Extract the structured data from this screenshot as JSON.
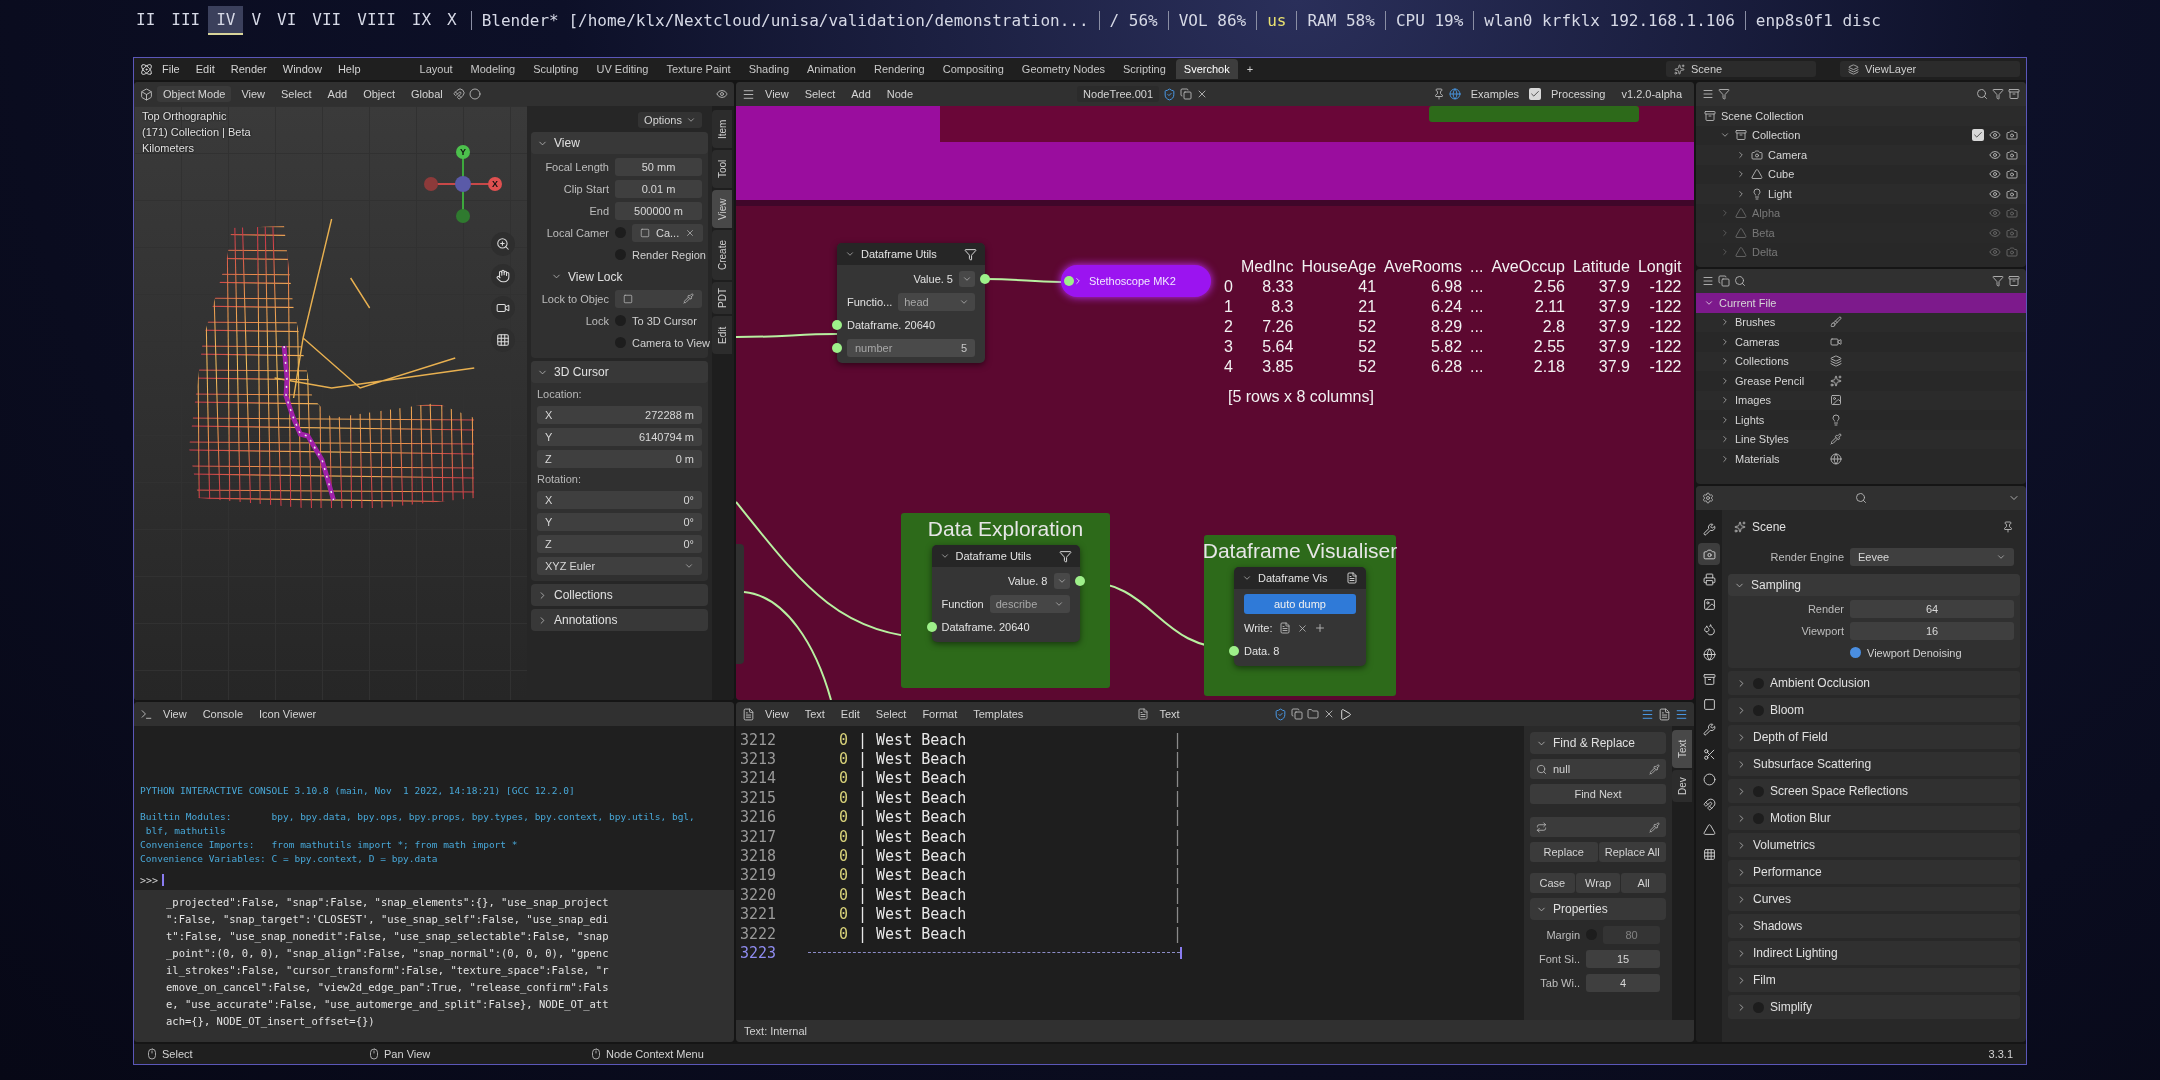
{
  "desktop_bar": {
    "workspaces": [
      {
        "label": "II",
        "selected": false
      },
      {
        "label": "III",
        "selected": false
      },
      {
        "label": "IV",
        "selected": true
      },
      {
        "label": "V",
        "selected": false
      },
      {
        "label": "VI",
        "selected": false
      },
      {
        "label": "VII",
        "selected": false
      },
      {
        "label": "VIII",
        "selected": false
      },
      {
        "label": "IX",
        "selected": false
      },
      {
        "label": "X",
        "selected": false
      }
    ],
    "title": "Blender* [/home/klx/Nextcloud/unisa/validation/demonstration...",
    "stats": [
      "/ 56%",
      "VOL 86%",
      "us",
      "RAM 58%",
      "CPU 19%",
      "wlan0 krfklx 192.168.1.106",
      "enp8s0f1 disc"
    ]
  },
  "topbar": {
    "menus": [
      "File",
      "Edit",
      "Render",
      "Window",
      "Help"
    ],
    "workspace_tabs": [
      {
        "label": "Layout",
        "selected": false
      },
      {
        "label": "Modeling",
        "selected": false
      },
      {
        "label": "Sculpting",
        "selected": false
      },
      {
        "label": "UV Editing",
        "selected": false
      },
      {
        "label": "Texture Paint",
        "selected": false
      },
      {
        "label": "Shading",
        "selected": false
      },
      {
        "label": "Animation",
        "selected": false
      },
      {
        "label": "Rendering",
        "selected": false
      },
      {
        "label": "Compositing",
        "selected": false
      },
      {
        "label": "Geometry Nodes",
        "selected": false
      },
      {
        "label": "Scripting",
        "selected": false
      },
      {
        "label": "Sverchok",
        "selected": true
      }
    ],
    "add_tab": "+",
    "scene": "Scene",
    "view_layer": "ViewLayer"
  },
  "viewport": {
    "mode": "Object Mode",
    "menus": [
      "View",
      "Select",
      "Add",
      "Object"
    ],
    "orientation": "Global",
    "options": "Options",
    "overlay": [
      "Top Orthographic",
      "(171) Collection | Beta",
      "Kilometers"
    ],
    "gizmo": {
      "y": "Y",
      "x": "X"
    },
    "sidebar_tabs": [
      {
        "label": "Item",
        "selected": false
      },
      {
        "label": "Tool",
        "selected": false
      },
      {
        "label": "View",
        "selected": true
      },
      {
        "label": "Create",
        "selected": false
      },
      {
        "label": "PDT",
        "selected": false
      },
      {
        "label": "Edit",
        "selected": false
      }
    ],
    "view_panel": {
      "title": "View",
      "rows": [
        {
          "kind": "field",
          "label": "Focal Length",
          "value": "50 mm"
        },
        {
          "kind": "field",
          "label": "Clip Start",
          "value": "0.01 m"
        },
        {
          "kind": "field",
          "label": "End",
          "value": "500000 m"
        },
        {
          "kind": "camera",
          "label": "Local Camer",
          "checked": false,
          "value": "Ca..."
        },
        {
          "kind": "check",
          "label": "Render Region",
          "checked": false
        },
        {
          "kind": "subhead",
          "label": "View Lock"
        },
        {
          "kind": "picker",
          "label": "Lock to Objec"
        },
        {
          "kind": "check",
          "prefix": "Lock",
          "label": "To 3D Cursor",
          "checked": false
        },
        {
          "kind": "check",
          "label": "Camera to View",
          "checked": false
        }
      ]
    },
    "cursor_panel": {
      "title": "3D Cursor",
      "rows": [
        {
          "kind": "caption",
          "label": "Location:"
        },
        {
          "kind": "vector",
          "label": "X",
          "value": "272288 m"
        },
        {
          "kind": "vector",
          "label": "Y",
          "value": "6140794 m"
        },
        {
          "kind": "vector",
          "label": "Z",
          "value": "0 m"
        },
        {
          "kind": "caption",
          "label": "Rotation:"
        },
        {
          "kind": "vector",
          "label": "X",
          "value": "0°"
        },
        {
          "kind": "vector",
          "label": "Y",
          "value": "0°"
        },
        {
          "kind": "vector",
          "label": "Z",
          "value": "0°"
        },
        {
          "kind": "select",
          "value": "XYZ Euler"
        }
      ]
    },
    "collapsed_panels": [
      "Collections",
      "Annotations"
    ]
  },
  "console": {
    "menus": [
      "View",
      "Console",
      "Icon Viewer"
    ],
    "banner": [
      "PYTHON INTERACTIVE CONSOLE 3.10.8 (main, Nov  1 2022, 14:18:21) [GCC 12.2.0]",
      "Builtin Modules:       bpy, bpy.data, bpy.ops, bpy.props, bpy.types, bpy.context, bpy.utils, bgl,",
      " blf, mathutils",
      "Convenience Imports:   from mathutils import *; from math import *",
      "Convenience Variables: C = bpy.context, D = bpy.data"
    ],
    "prompt": ">>>",
    "report": [
      "_projected\":False, \"snap\":False, \"snap_elements\":{}, \"use_snap_project",
      "\":False, \"snap_target\":'CLOSEST', \"use_snap_self\":False, \"use_snap_edi",
      "t\":False, \"use_snap_nonedit\":False, \"use_snap_selectable\":False, \"snap",
      "_point\":(0, 0, 0), \"snap_align\":False, \"snap_normal\":(0, 0, 0), \"gpenc",
      "il_strokes\":False, \"cursor_transform\":False, \"texture_space\":False, \"r",
      "emove_on_cancel\":False, \"view2d_edge_pan\":True, \"release_confirm\":Fals",
      "e, \"use_accurate\":False, \"use_automerge_and_split\":False}, NODE_OT_att",
      "ach={}, NODE_OT_insert_offset={})"
    ]
  },
  "node_editor": {
    "menus": [
      "View",
      "Select",
      "Add",
      "Node"
    ],
    "tree": "NodeTree.001",
    "examples": "Examples",
    "processing": {
      "label": "Processing",
      "checked": true
    },
    "version": "v1.2.0-alpha",
    "utils_node": {
      "title": "Dataframe Utils",
      "value": "Value. 5",
      "function_label": "Functio...",
      "function": "head",
      "input": "Dataframe. 20640",
      "number_label": "number",
      "number": "5"
    },
    "stethoscope": {
      "title": "Stethoscope MK2",
      "columns": [
        "",
        "MedInc",
        "HouseAge",
        "AveRooms",
        "...",
        "AveOccup",
        "Latitude",
        "Longit"
      ],
      "rows": [
        [
          "0",
          "8.33",
          "41",
          "6.98",
          "...",
          "2.56",
          "37.9",
          "-122"
        ],
        [
          "1",
          "8.3",
          "21",
          "6.24",
          "...",
          "2.11",
          "37.9",
          "-122"
        ],
        [
          "2",
          "7.26",
          "52",
          "8.29",
          "...",
          "2.8",
          "37.9",
          "-122"
        ],
        [
          "3",
          "5.64",
          "52",
          "5.82",
          "...",
          "2.55",
          "37.9",
          "-122"
        ],
        [
          "4",
          "3.85",
          "52",
          "6.28",
          "...",
          "2.18",
          "37.9",
          "-122"
        ]
      ],
      "summary": "[5 rows x 8 columns]"
    },
    "exploration_frame": {
      "title": "Data Exploration",
      "node": {
        "title": "Dataframe Utils",
        "value": "Value. 8",
        "function_label": "Function",
        "function": "describe",
        "input": "Dataframe. 20640"
      }
    },
    "visualiser_frame": {
      "title": "Dataframe Visualiser",
      "node": {
        "title": "Dataframe Vis",
        "button": {
          "label": "auto dump",
          "on": true
        },
        "write_label": "Write:",
        "input": "Data. 8"
      }
    }
  },
  "text_editor": {
    "menus": [
      "View",
      "Text",
      "Edit",
      "Select",
      "Format",
      "Templates"
    ],
    "text": "Text",
    "lines": [
      {
        "number": "3212",
        "count": "0",
        "text": "| West Beach",
        "end": "|",
        "current": false
      },
      {
        "number": "3213",
        "count": "0",
        "text": "| West Beach",
        "end": "|",
        "current": false
      },
      {
        "number": "3214",
        "count": "0",
        "text": "| West Beach",
        "end": "|",
        "current": false
      },
      {
        "number": "3215",
        "count": "0",
        "text": "| West Beach",
        "end": "|",
        "current": false
      },
      {
        "number": "3216",
        "count": "0",
        "text": "| West Beach",
        "end": "|",
        "current": false
      },
      {
        "number": "3217",
        "count": "0",
        "text": "| West Beach",
        "end": "|",
        "current": false
      },
      {
        "number": "3218",
        "count": "0",
        "text": "| West Beach",
        "end": "|",
        "current": false
      },
      {
        "number": "3219",
        "count": "0",
        "text": "| West Beach",
        "end": "|",
        "current": false
      },
      {
        "number": "3220",
        "count": "0",
        "text": "| West Beach",
        "end": "|",
        "current": false
      },
      {
        "number": "3221",
        "count": "0",
        "text": "| West Beach",
        "end": "|",
        "current": false
      },
      {
        "number": "3222",
        "count": "0",
        "text": "| West Beach",
        "end": "|",
        "current": false
      },
      {
        "number": "3223",
        "current": true
      }
    ],
    "footer": "Text: Internal",
    "sidebar_tabs": [
      {
        "label": "Text",
        "selected": true
      },
      {
        "label": "Dev",
        "selected": false
      }
    ],
    "find": {
      "title": "Find & Replace",
      "query": "null",
      "find_next": "Find Next",
      "replace": "Replace",
      "replace_all": "Replace All",
      "options": [
        {
          "label": "Case",
          "on": false
        },
        {
          "label": "Wrap",
          "on": false
        },
        {
          "label": "All",
          "on": false
        }
      ]
    },
    "properties": {
      "title": "Properties",
      "rows": [
        {
          "label": "Margin",
          "value": "80",
          "checked": false
        },
        {
          "label": "Font Si..",
          "value": "15"
        },
        {
          "label": "Tab Wi..",
          "value": "4"
        }
      ]
    }
  },
  "outliner": {
    "title": "Scene Collection",
    "items": [
      {
        "label": "Collection",
        "checked": true,
        "excluded": false,
        "children": [
          {
            "label": "Camera",
            "excluded": false
          },
          {
            "label": "Cube",
            "excluded": false
          },
          {
            "label": "Light",
            "excluded": false
          }
        ]
      },
      {
        "label": "Alpha",
        "excluded": true
      },
      {
        "label": "Beta",
        "excluded": true
      },
      {
        "label": "Delta",
        "excluded": true
      }
    ]
  },
  "blend_file": {
    "root": {
      "label": "Current File",
      "selected": true
    },
    "items": [
      "Brushes",
      "Cameras",
      "Collections",
      "Grease Pencil",
      "Images",
      "Lights",
      "Line Styles",
      "Materials"
    ]
  },
  "properties": {
    "tabs": [
      {
        "selected": false
      },
      {
        "selected": true
      },
      {
        "selected": false
      },
      {
        "selected": false
      },
      {
        "selected": false
      },
      {
        "selected": false
      },
      {
        "selected": false
      },
      {
        "selected": false
      },
      {
        "selected": false
      },
      {
        "selected": false
      },
      {
        "selected": false
      },
      {
        "selected": false
      },
      {
        "selected": false
      },
      {
        "selected": false
      }
    ],
    "context": "Scene",
    "render_engine": {
      "label": "Render Engine",
      "value": "Eevee"
    },
    "sampling": {
      "title": "Sampling",
      "render": {
        "label": "Render",
        "value": "64"
      },
      "viewport": {
        "label": "Viewport",
        "value": "16"
      },
      "denoising": {
        "label": "Viewport Denoising",
        "checked": true
      }
    },
    "panels": [
      {
        "label": "Ambient Occlusion",
        "kind": "toggle",
        "on": false
      },
      {
        "label": "Bloom",
        "kind": "toggle",
        "on": false
      },
      {
        "label": "Depth of Field",
        "kind": "plain"
      },
      {
        "label": "Subsurface Scattering",
        "kind": "plain"
      },
      {
        "label": "Screen Space Reflections",
        "kind": "toggle",
        "on": false
      },
      {
        "label": "Motion Blur",
        "kind": "toggle",
        "on": false
      },
      {
        "label": "Volumetrics",
        "kind": "plain"
      },
      {
        "label": "Performance",
        "kind": "plain"
      },
      {
        "label": "Curves",
        "kind": "plain"
      },
      {
        "label": "Shadows",
        "kind": "plain"
      },
      {
        "label": "Indirect Lighting",
        "kind": "plain"
      },
      {
        "label": "Film",
        "kind": "plain"
      },
      {
        "label": "Simplify",
        "kind": "toggle",
        "on": false
      }
    ]
  },
  "status_bar": {
    "items": [
      "Select",
      "Pan View",
      "Node Context Menu"
    ],
    "version": "3.3.1"
  }
}
